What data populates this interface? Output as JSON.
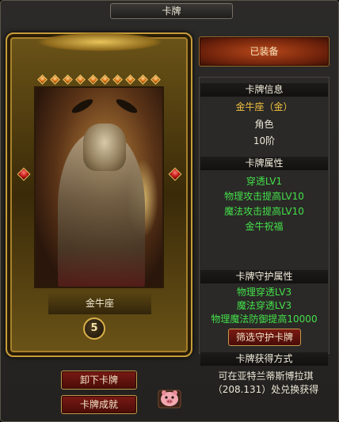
{
  "window": {
    "title": "卡牌"
  },
  "card": {
    "name": "金牛座",
    "level": "5"
  },
  "buttons": {
    "unequip": "卸下卡牌",
    "achievement": "卡牌成就",
    "equipped": "已装备",
    "filter_guard": "筛选守护卡牌"
  },
  "info": {
    "header": "卡牌信息",
    "name": "金牛座（金）",
    "type": "角色",
    "rank": "10阶"
  },
  "attributes": {
    "header": "卡牌属性",
    "items": [
      "穿透LV1",
      "物理攻击提高LV10",
      "魔法攻击提高LV10",
      "金牛祝福"
    ]
  },
  "guard": {
    "header": "卡牌守护属性",
    "items": [
      "物理穿透LV3",
      "魔法穿透LV3",
      "物理魔法防御提高10000"
    ]
  },
  "obtain": {
    "header": "卡牌获得方式",
    "text": "可在亚特兰蒂斯博拉琪（208.131）处兑换获得"
  },
  "colors": {
    "gold_text": "#f0c040",
    "green_text": "#44e04a",
    "frame_gold": "#c79d3a"
  }
}
